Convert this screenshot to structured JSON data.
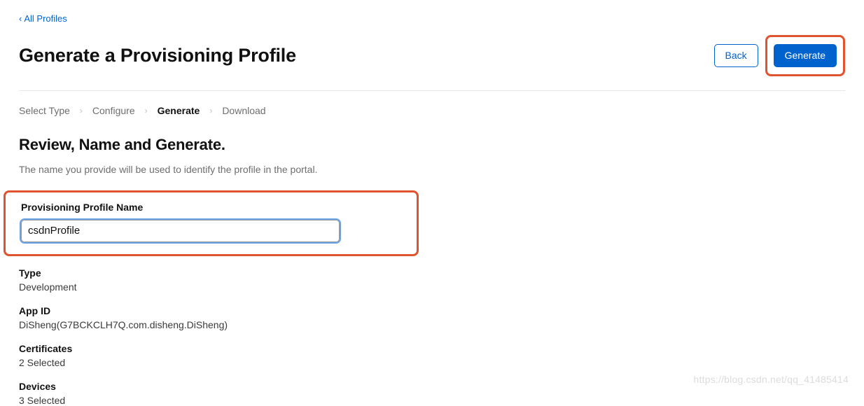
{
  "nav": {
    "back_link": "All Profiles"
  },
  "header": {
    "title": "Generate a Provisioning Profile",
    "back_button": "Back",
    "generate_button": "Generate"
  },
  "breadcrumb": {
    "steps": [
      "Select Type",
      "Configure",
      "Generate",
      "Download"
    ],
    "active_index": 2
  },
  "section": {
    "title": "Review, Name and Generate.",
    "desc": "The name you provide will be used to identify the profile in the portal."
  },
  "form": {
    "profile_name_label": "Provisioning Profile Name",
    "profile_name_value": "csdnProfile"
  },
  "info": {
    "type_label": "Type",
    "type_value": "Development",
    "appid_label": "App ID",
    "appid_value": "DiSheng(G7BCKCLH7Q.com.disheng.DiSheng)",
    "certs_label": "Certificates",
    "certs_value": "2 Selected",
    "devices_label": "Devices",
    "devices_value": "3 Selected"
  },
  "watermark": "https://blog.csdn.net/qq_41485414"
}
